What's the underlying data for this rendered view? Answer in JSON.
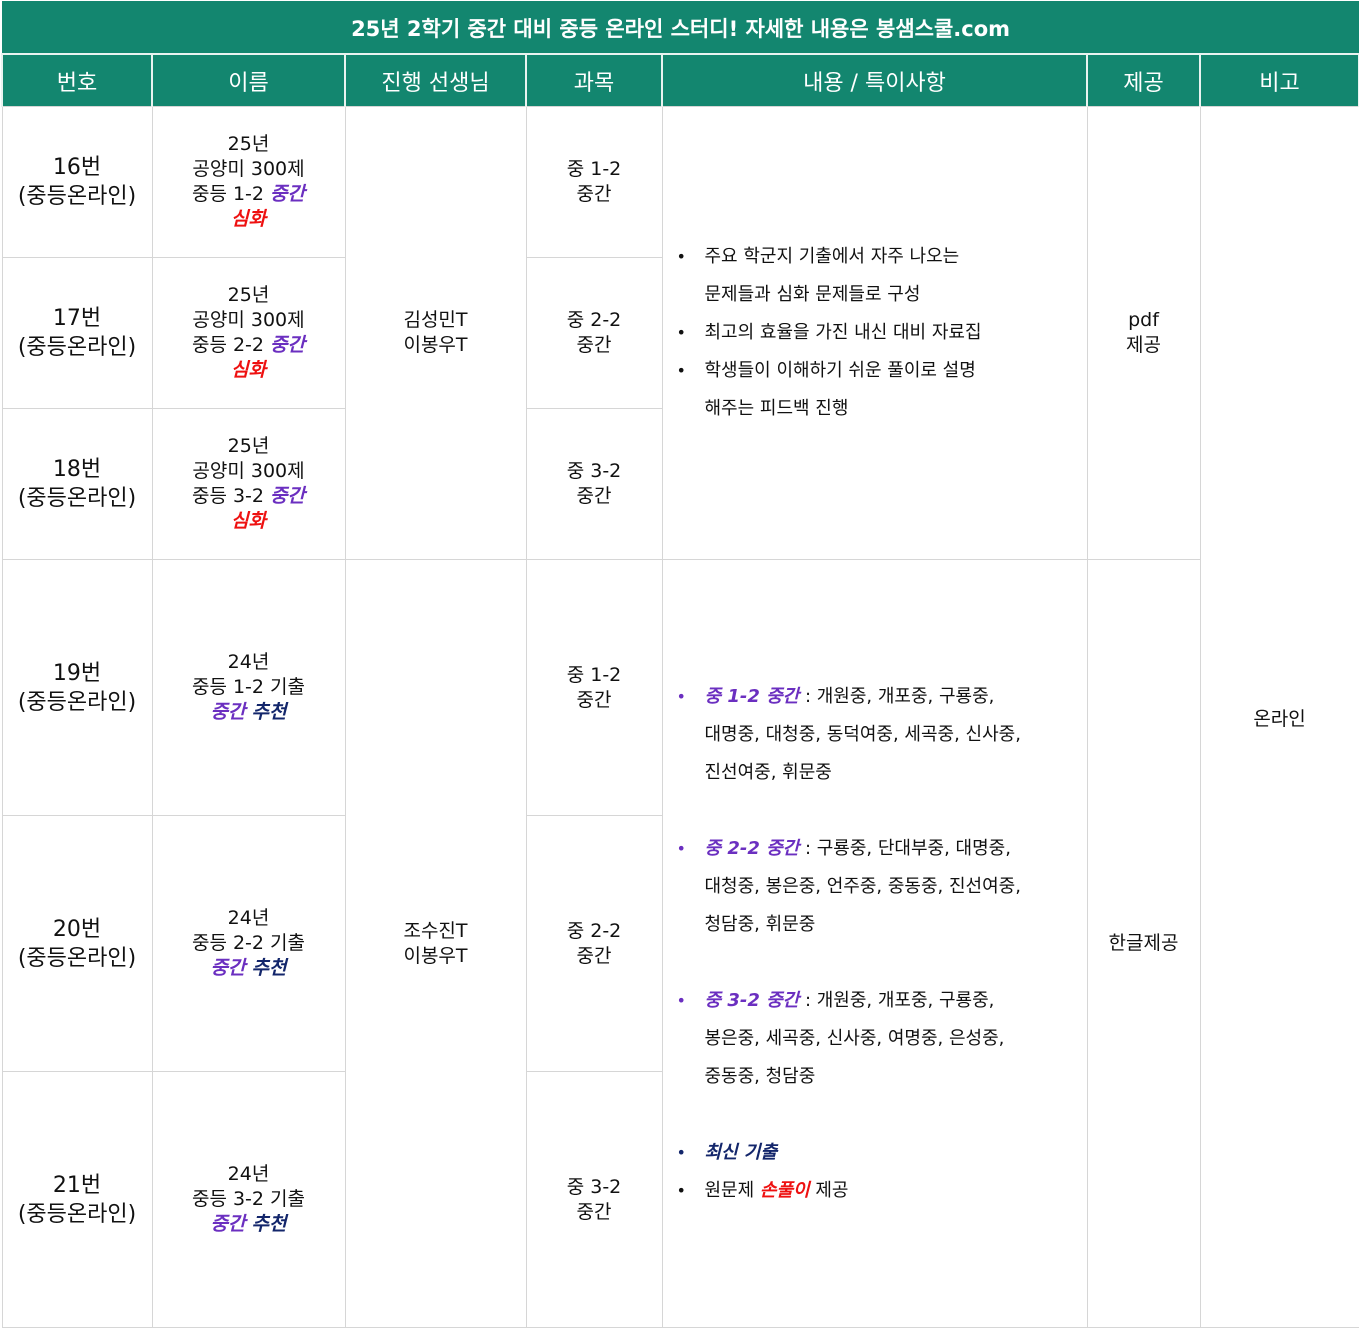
{
  "banner": "25년 2학기 중간 대비 중등 온라인 스터디! 자세한 내용은 봉샘스쿨.com",
  "headers": {
    "number": "번호",
    "name": "이름",
    "teacher": "진행 선생님",
    "subject": "과목",
    "content": "내용 / 특이사항",
    "provided": "제공",
    "note": "비고"
  },
  "rows": [
    {
      "num": "16번",
      "type": "(중등온라인)",
      "name_l1": "25년",
      "name_l2": "공양미 300제",
      "name_l3a": "중등 1-2 ",
      "name_l3b": "중간",
      "name_l4": "심화",
      "subj_l1": "중 1-2",
      "subj_l2": "중간"
    },
    {
      "num": "17번",
      "type": "(중등온라인)",
      "name_l1": "25년",
      "name_l2": "공양미 300제",
      "name_l3a": "중등 2-2 ",
      "name_l3b": "중간",
      "name_l4": "심화",
      "subj_l1": "중 2-2",
      "subj_l2": "중간"
    },
    {
      "num": "18번",
      "type": "(중등온라인)",
      "name_l1": "25년",
      "name_l2": "공양미 300제",
      "name_l3a": "중등 3-2 ",
      "name_l3b": "중간",
      "name_l4": "심화",
      "subj_l1": "중 3-2",
      "subj_l2": "중간"
    },
    {
      "num": "19번",
      "type": "(중등온라인)",
      "name_l1": "24년",
      "name_l2": "중등 1-2 기출",
      "name_l3a": "중간",
      "name_l3b": "추천",
      "subj_l1": "중 1-2",
      "subj_l2": "중간"
    },
    {
      "num": "20번",
      "type": "(중등온라인)",
      "name_l1": "24년",
      "name_l2": "중등 2-2 기출",
      "name_l3a": "중간",
      "name_l3b": "추천",
      "subj_l1": "중 2-2",
      "subj_l2": "중간"
    },
    {
      "num": "21번",
      "type": "(중등온라인)",
      "name_l1": "24년",
      "name_l2": "중등 3-2 기출",
      "name_l3a": "중간",
      "name_l3b": "추천",
      "subj_l1": "중 3-2",
      "subj_l2": "중간"
    }
  ],
  "group1": {
    "teacher_l1": "김성민T",
    "teacher_l2": "이봉우T",
    "bullets": [
      "주요 학군지 기출에서 자주 나오는",
      "문제들과 심화 문제들로 구성",
      "최고의 효율을 가진 내신 대비 자료집",
      "학생들이 이해하기 쉬운 풀이로 설명",
      "해주는 피드백 진행"
    ],
    "provided_l1": "pdf",
    "provided_l2": "제공"
  },
  "group2": {
    "teacher_l1": "조수진T",
    "teacher_l2": "이봉우T",
    "s1_tag": "중 1-2 중간",
    "s1_l1": " : 개원중, 개포중, 구룡중,",
    "s1_l2": "대명중, 대청중, 동덕여중, 세곡중, 신사중,",
    "s1_l3": "진선여중, 휘문중",
    "s2_tag": "중 2-2 중간",
    "s2_l1": " : 구룡중, 단대부중, 대명중,",
    "s2_l2": "대청중, 봉은중, 언주중, 중동중, 진선여중,",
    "s2_l3": "청담중, 휘문중",
    "s3_tag": "중 3-2 중간",
    "s3_l1": " : 개원중, 개포중, 구룡중,",
    "s3_l2": "봉은중, 세곡중, 신사중, 여명중, 은성중,",
    "s3_l3": "중동중, 청담중",
    "latest": "최신 기출",
    "orig_a": "원문제 ",
    "orig_b": "손풀이",
    "orig_c": " 제공",
    "provided": "한글제공"
  },
  "note": "온라인",
  "bullet_char": "•",
  "colors": {
    "header_bg": "#13866f",
    "purple": "#6b2fc0",
    "red": "#ee1111",
    "navy": "#13266b"
  }
}
